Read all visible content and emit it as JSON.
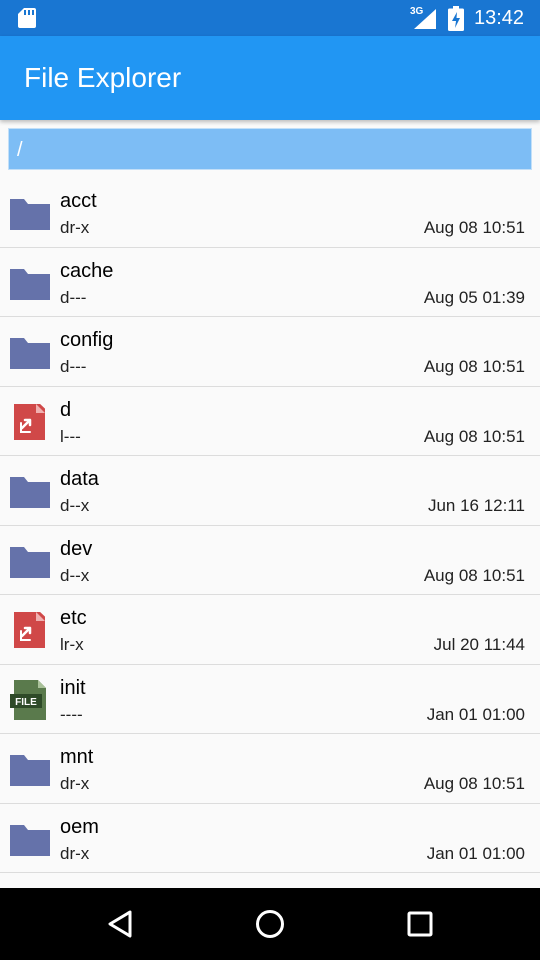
{
  "status_bar": {
    "network_type": "3G",
    "time": "13:42",
    "icons": [
      "sd-card-icon",
      "signal-icon",
      "battery-icon"
    ]
  },
  "app_bar": {
    "title": "File Explorer"
  },
  "path": "/",
  "files": [
    {
      "name": "acct",
      "perm": "dr-x",
      "date": "Aug 08 10:51",
      "icon": "folder-icon"
    },
    {
      "name": "cache",
      "perm": "d---",
      "date": "Aug 05 01:39",
      "icon": "folder-icon"
    },
    {
      "name": "config",
      "perm": "d---",
      "date": "Aug 08 10:51",
      "icon": "folder-icon"
    },
    {
      "name": "d",
      "perm": "l---",
      "date": "Aug 08 10:51",
      "icon": "symlink-icon"
    },
    {
      "name": "data",
      "perm": "d--x",
      "date": "Jun 16 12:11",
      "icon": "folder-icon"
    },
    {
      "name": "dev",
      "perm": "d--x",
      "date": "Aug 08 10:51",
      "icon": "folder-icon"
    },
    {
      "name": "etc",
      "perm": "lr-x",
      "date": "Jul 20 11:44",
      "icon": "symlink-icon"
    },
    {
      "name": "init",
      "perm": "----",
      "date": "Jan 01 01:00",
      "icon": "file-icon",
      "icon_label": "FILE"
    },
    {
      "name": "mnt",
      "perm": "dr-x",
      "date": "Aug 08 10:51",
      "icon": "folder-icon"
    },
    {
      "name": "oem",
      "perm": "dr-x",
      "date": "Jan 01 01:00",
      "icon": "folder-icon"
    }
  ],
  "nav_bar": {
    "buttons": [
      "back",
      "home",
      "recents"
    ]
  },
  "colors": {
    "status_bar": "#1976d2",
    "app_bar": "#2196f3",
    "path_bar": "#7dbdf5",
    "folder": "#6572aa",
    "symlink": "#d04848",
    "file": "#5a7a4c"
  }
}
